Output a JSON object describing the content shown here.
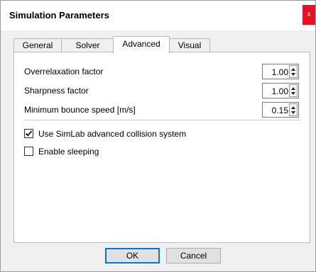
{
  "dialog": {
    "title": "Simulation Parameters",
    "close_label": "x",
    "accent": "#0078d7",
    "close_color": "#e81123"
  },
  "tabs": [
    {
      "label": "General",
      "active": false
    },
    {
      "label": "Solver",
      "active": false
    },
    {
      "label": "Advanced",
      "active": true
    },
    {
      "label": "Visual",
      "active": false
    }
  ],
  "advanced": {
    "fields": [
      {
        "label": "Overrelaxation factor",
        "value": "1.00"
      },
      {
        "label": "Sharpness factor",
        "value": "1.00"
      },
      {
        "label": "Minimum bounce speed [m/s]",
        "value": "0.15"
      }
    ],
    "checkboxes": [
      {
        "label": "Use SimLab advanced collision system",
        "checked": true
      },
      {
        "label": "Enable sleeping",
        "checked": false
      }
    ]
  },
  "buttons": {
    "ok_label": "OK",
    "cancel_label": "Cancel"
  }
}
